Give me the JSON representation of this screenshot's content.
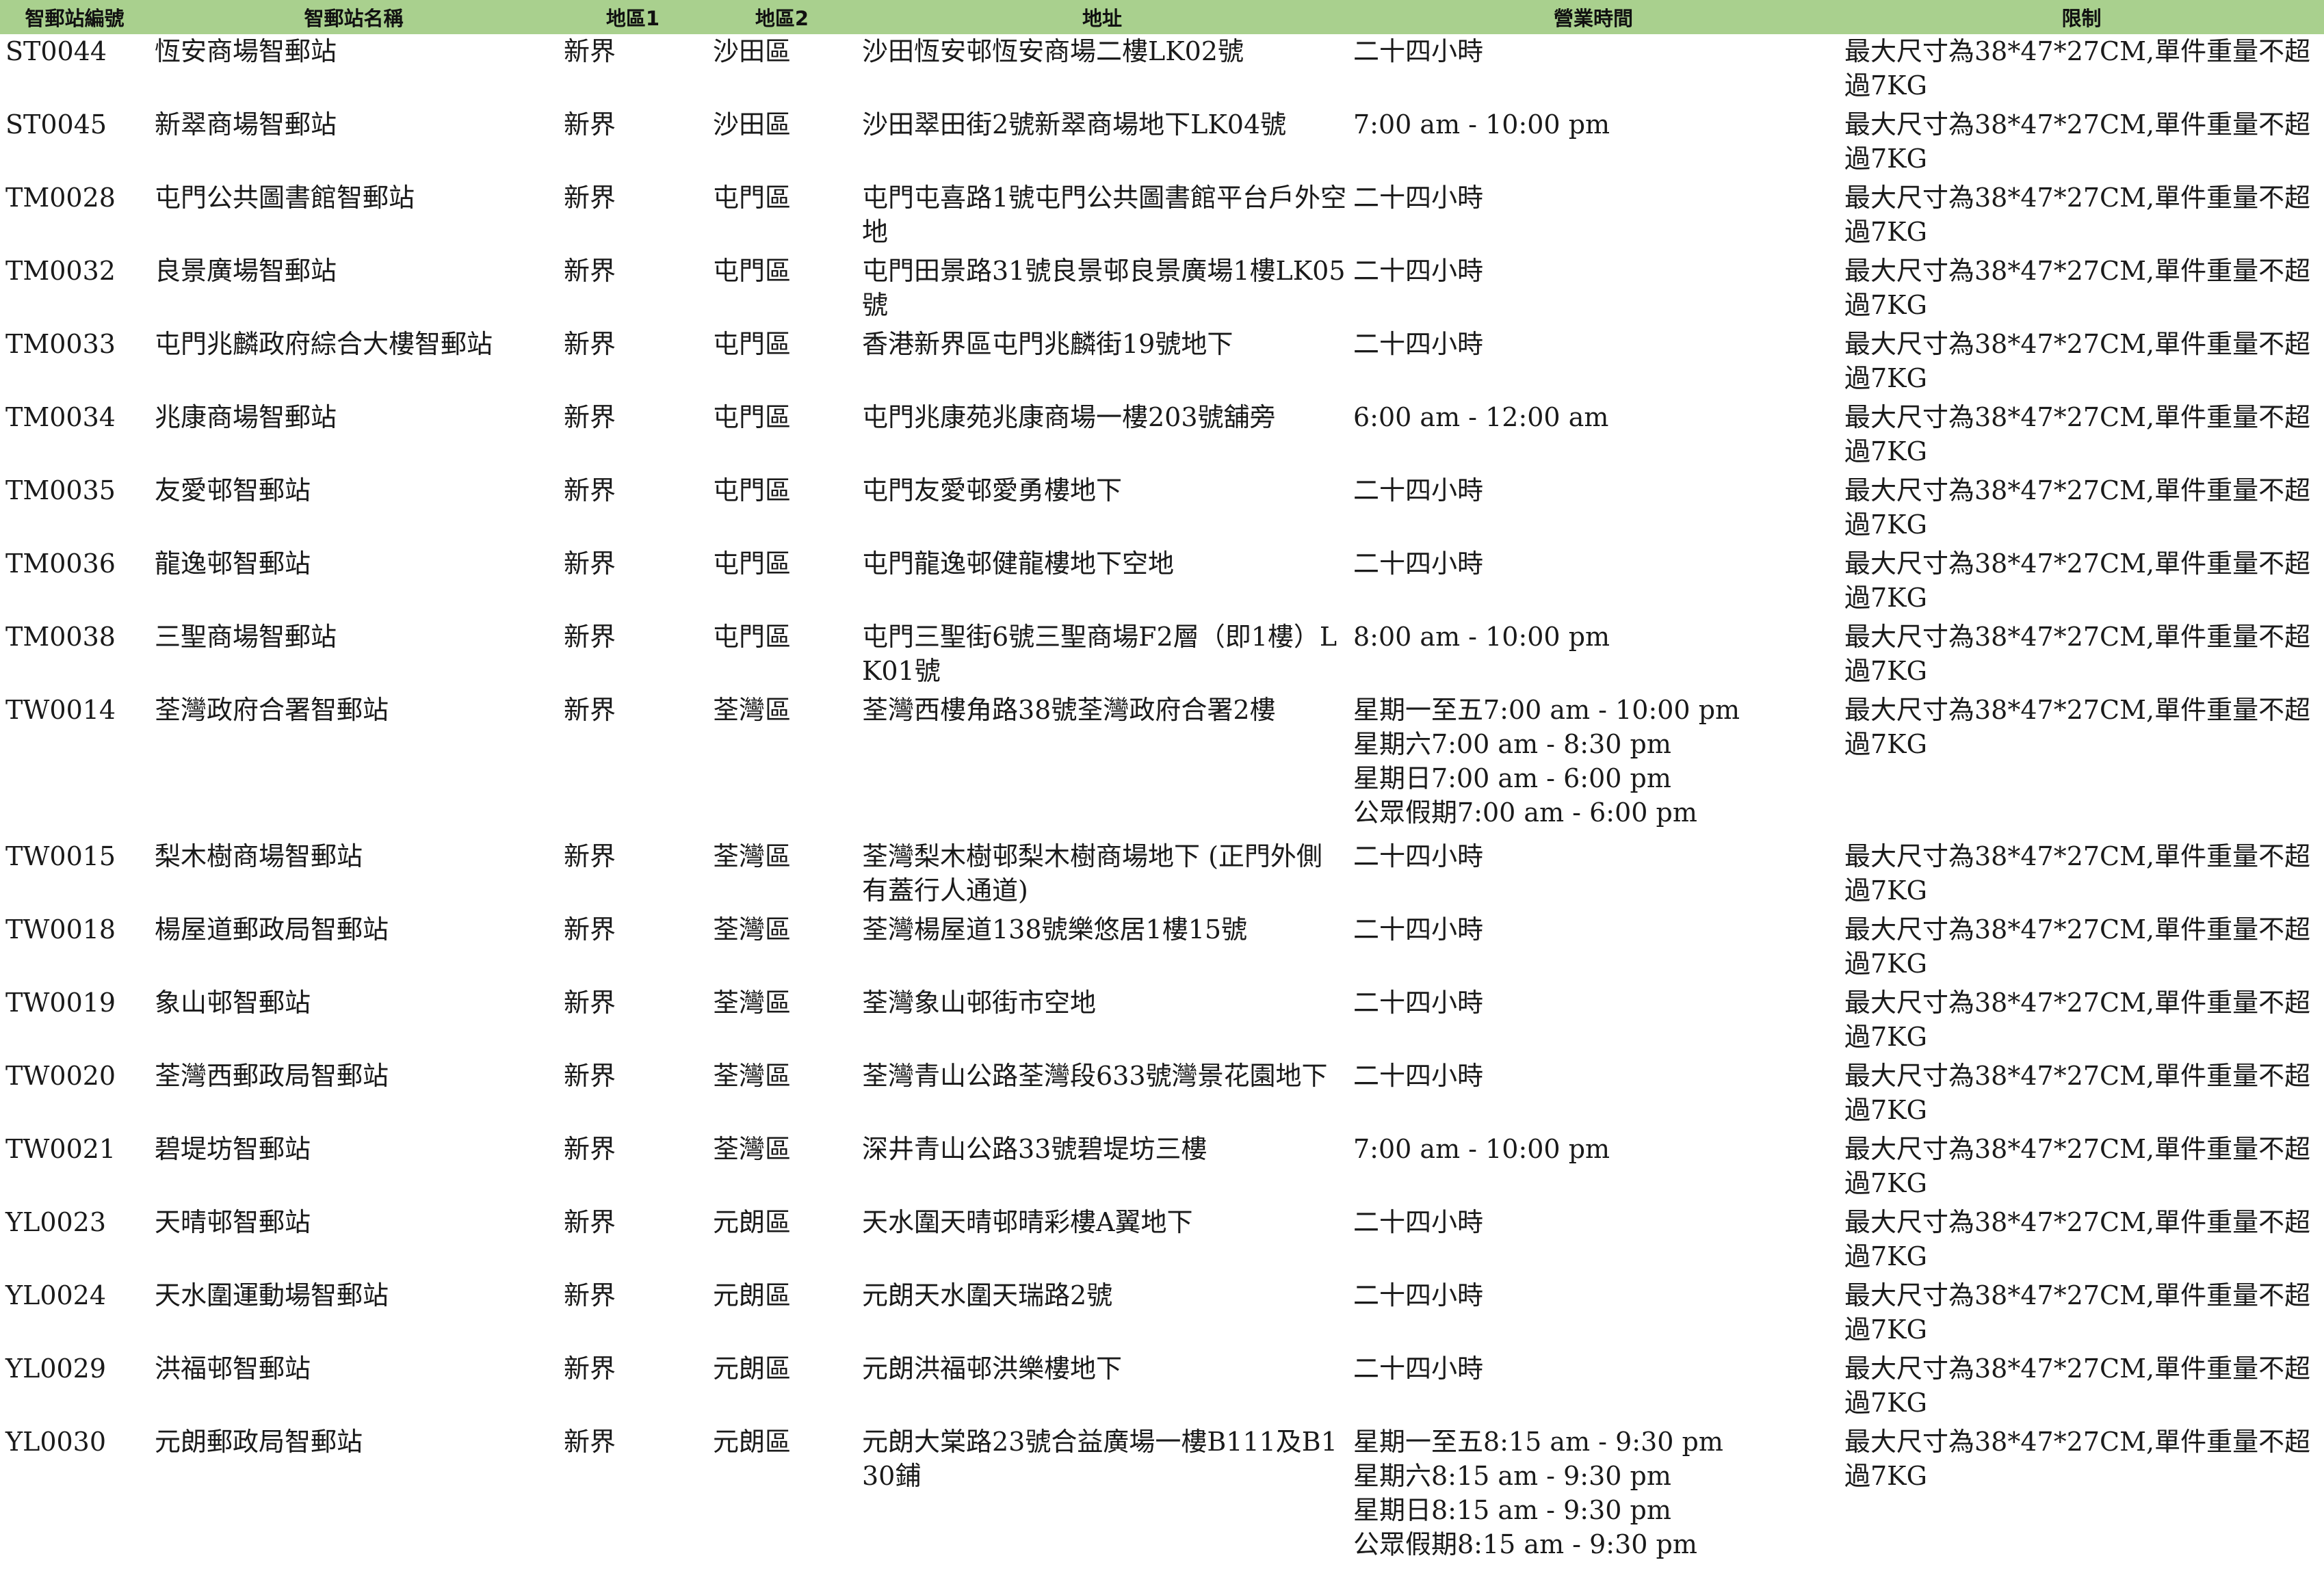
{
  "table": {
    "headers": [
      "智郵站編號",
      "智郵站名稱",
      "地區1",
      "地區2",
      "地址",
      "營業時間",
      "限制"
    ],
    "rows": [
      {
        "id": "ST0044",
        "name": "恆安商場智郵站",
        "region1": "新界",
        "region2": "沙田區",
        "address": "沙田恆安邨恆安商場二樓LK02號",
        "hours": [
          "二十四小時"
        ],
        "limit": "最大尺寸為38*47*27CM,單件重量不超過7KG"
      },
      {
        "id": "ST0045",
        "name": "新翠商場智郵站",
        "region1": "新界",
        "region2": "沙田區",
        "address": "沙田翠田街2號新翠商場地下LK04號",
        "hours": [
          "7:00 am - 10:00 pm"
        ],
        "limit": "最大尺寸為38*47*27CM,單件重量不超過7KG"
      },
      {
        "id": "TM0028",
        "name": "屯門公共圖書館智郵站",
        "region1": "新界",
        "region2": "屯門區",
        "address": "屯門屯喜路1號屯門公共圖書館平台戶外空地",
        "hours": [
          "二十四小時"
        ],
        "limit": "最大尺寸為38*47*27CM,單件重量不超過7KG"
      },
      {
        "id": "TM0032",
        "name": "良景廣場智郵站",
        "region1": "新界",
        "region2": "屯門區",
        "address": "屯門田景路31號良景邨良景廣場1樓LK05號",
        "hours": [
          "二十四小時"
        ],
        "limit": "最大尺寸為38*47*27CM,單件重量不超過7KG"
      },
      {
        "id": "TM0033",
        "name": "屯門兆麟政府綜合大樓智郵站",
        "region1": "新界",
        "region2": "屯門區",
        "address": "香港新界區屯門兆麟街19號地下",
        "hours": [
          "二十四小時"
        ],
        "limit": "最大尺寸為38*47*27CM,單件重量不超過7KG"
      },
      {
        "id": "TM0034",
        "name": "兆康商場智郵站",
        "region1": "新界",
        "region2": "屯門區",
        "address": "屯門兆康苑兆康商場一樓203號舖旁",
        "hours": [
          "6:00 am - 12:00 am"
        ],
        "limit": "最大尺寸為38*47*27CM,單件重量不超過7KG"
      },
      {
        "id": "TM0035",
        "name": "友愛邨智郵站",
        "region1": "新界",
        "region2": "屯門區",
        "address": "屯門友愛邨愛勇樓地下",
        "hours": [
          "二十四小時"
        ],
        "limit": "最大尺寸為38*47*27CM,單件重量不超過7KG"
      },
      {
        "id": "TM0036",
        "name": "龍逸邨智郵站",
        "region1": "新界",
        "region2": "屯門區",
        "address": "屯門龍逸邨健龍樓地下空地",
        "hours": [
          "二十四小時"
        ],
        "limit": "最大尺寸為38*47*27CM,單件重量不超過7KG"
      },
      {
        "id": "TM0038",
        "name": "三聖商場智郵站",
        "region1": "新界",
        "region2": "屯門區",
        "address": "屯門三聖街6號三聖商場F2層（即1樓）LK01號",
        "hours": [
          "8:00 am - 10:00 pm"
        ],
        "limit": "最大尺寸為38*47*27CM,單件重量不超過7KG"
      },
      {
        "id": "TW0014",
        "name": "荃灣政府合署智郵站",
        "region1": "新界",
        "region2": "荃灣區",
        "address": "荃灣西樓角路38號荃灣政府合署2樓",
        "hours": [
          "星期一至五7:00 am - 10:00 pm",
          "星期六7:00 am - 8:30 pm",
          "星期日7:00 am - 6:00 pm",
          "公眾假期7:00 am - 6:00 pm"
        ],
        "limit": "最大尺寸為38*47*27CM,單件重量不超過7KG"
      },
      {
        "id": "TW0015",
        "name": "梨木樹商場智郵站",
        "region1": "新界",
        "region2": "荃灣區",
        "address": "荃灣梨木樹邨梨木樹商場地下 (正門外側有蓋行人通道)",
        "hours": [
          "二十四小時"
        ],
        "limit": "最大尺寸為38*47*27CM,單件重量不超過7KG"
      },
      {
        "id": "TW0018",
        "name": "楊屋道郵政局智郵站",
        "region1": "新界",
        "region2": "荃灣區",
        "address": "荃灣楊屋道138號樂悠居1樓15號",
        "hours": [
          "二十四小時"
        ],
        "limit": "最大尺寸為38*47*27CM,單件重量不超過7KG"
      },
      {
        "id": "TW0019",
        "name": "象山邨智郵站",
        "region1": "新界",
        "region2": "荃灣區",
        "address": "荃灣象山邨街市空地",
        "hours": [
          "二十四小時"
        ],
        "limit": "最大尺寸為38*47*27CM,單件重量不超過7KG"
      },
      {
        "id": "TW0020",
        "name": "荃灣西郵政局智郵站",
        "region1": "新界",
        "region2": "荃灣區",
        "address": "荃灣青山公路荃灣段633號灣景花園地下",
        "hours": [
          "二十四小時"
        ],
        "limit": "最大尺寸為38*47*27CM,單件重量不超過7KG"
      },
      {
        "id": "TW0021",
        "name": "碧堤坊智郵站",
        "region1": "新界",
        "region2": "荃灣區",
        "address": "深井青山公路33號碧堤坊三樓",
        "hours": [
          "7:00 am - 10:00 pm"
        ],
        "limit": "最大尺寸為38*47*27CM,單件重量不超過7KG"
      },
      {
        "id": "YL0023",
        "name": "天晴邨智郵站",
        "region1": "新界",
        "region2": "元朗區",
        "address": "天水圍天晴邨晴彩樓A翼地下",
        "hours": [
          "二十四小時"
        ],
        "limit": "最大尺寸為38*47*27CM,單件重量不超過7KG"
      },
      {
        "id": "YL0024",
        "name": "天水圍運動場智郵站",
        "region1": "新界",
        "region2": "元朗區",
        "address": "元朗天水圍天瑞路2號",
        "hours": [
          "二十四小時"
        ],
        "limit": "最大尺寸為38*47*27CM,單件重量不超過7KG"
      },
      {
        "id": "YL0029",
        "name": "洪福邨智郵站",
        "region1": "新界",
        "region2": "元朗區",
        "address": "元朗洪福邨洪樂樓地下",
        "hours": [
          "二十四小時"
        ],
        "limit": "最大尺寸為38*47*27CM,單件重量不超過7KG"
      },
      {
        "id": "YL0030",
        "name": "元朗郵政局智郵站",
        "region1": "新界",
        "region2": "元朗區",
        "address": "元朗大棠路23號合益廣場一樓B111及B130鋪",
        "hours": [
          "星期一至五8:15 am - 9:30 pm",
          "星期六8:15 am - 9:30 pm",
          "星期日8:15 am - 9:30 pm",
          "公眾假期8:15 am - 9:30 pm"
        ],
        "limit": "最大尺寸為38*47*27CM,單件重量不超過7KG"
      }
    ]
  }
}
